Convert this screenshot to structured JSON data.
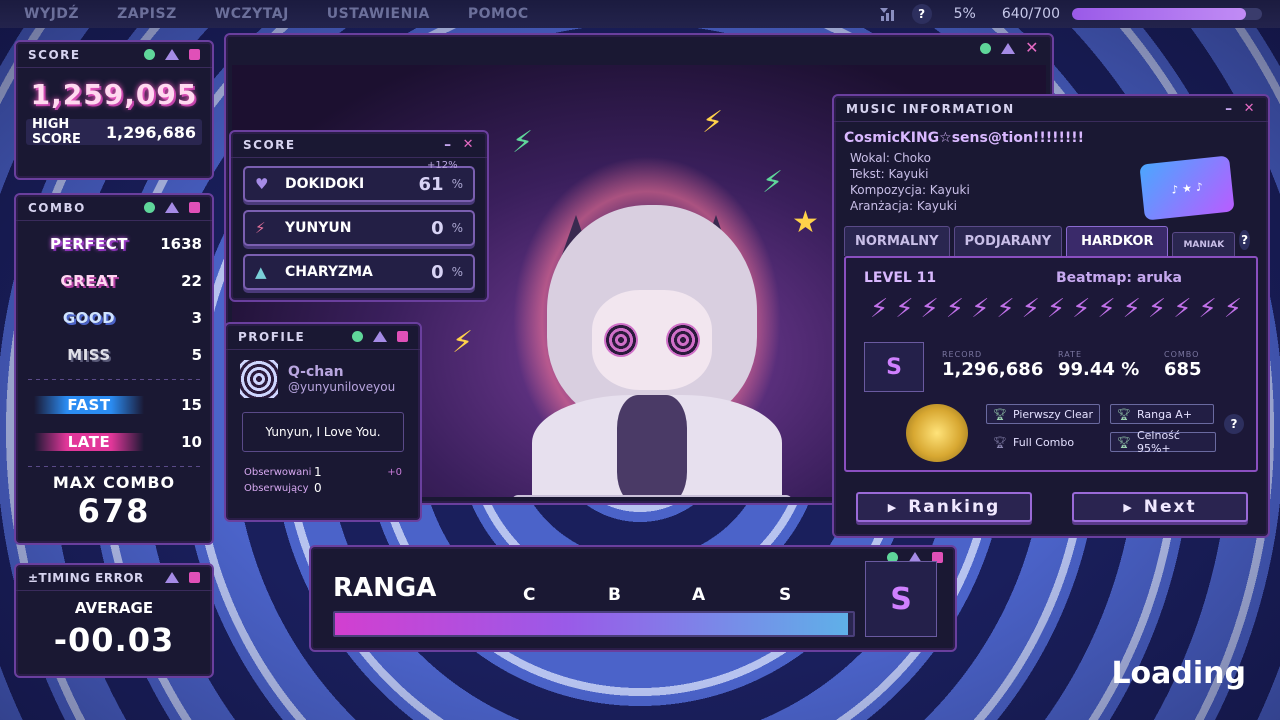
{
  "menu": [
    "WYJDŹ",
    "ZAPISZ",
    "WCZYTAJ",
    "USTAWIENIA",
    "POMOC"
  ],
  "topbar": {
    "help": "?",
    "percent": "5%",
    "progress_text": "640/700",
    "progress_fraction": 0.914
  },
  "score_panel": {
    "title": "SCORE",
    "score": "1,259,095",
    "high_score_label": "HIGH SCORE",
    "high_score": "1,296,686"
  },
  "combo_panel": {
    "title": "COMBO",
    "judgements": [
      {
        "label": "PERFECT",
        "value": "1638"
      },
      {
        "label": "GREAT",
        "value": "22"
      },
      {
        "label": "GOOD",
        "value": "3"
      },
      {
        "label": "MISS",
        "value": "5"
      }
    ],
    "fast": {
      "label": "FAST",
      "value": "15"
    },
    "late": {
      "label": "LATE",
      "value": "10"
    },
    "max_combo_label": "MAX COMBO",
    "max_combo": "678"
  },
  "timing_panel": {
    "title": "±TIMING ERROR",
    "average_label": "AVERAGE",
    "average": "-00.03"
  },
  "stats_panel": {
    "title": "SCORE",
    "bonus": "+12%",
    "rows": [
      {
        "label": "DOKIDOKI",
        "value": "61",
        "unit": "%",
        "icon": "heart-icon"
      },
      {
        "label": "YUNYUN",
        "value": "0",
        "unit": "%",
        "icon": "bolt-icon"
      },
      {
        "label": "CHARYZMA",
        "value": "0",
        "unit": "%",
        "icon": "eye-triangle-icon"
      }
    ]
  },
  "profile_panel": {
    "title": "PROFILE",
    "name": "Q-chan",
    "handle": "@yunyuniloveyou",
    "message": "Yunyun, I Love You.",
    "following_label": "Obserwowani",
    "following": "1",
    "following_delta": "+0",
    "followers_label": "Obserwujący",
    "followers": "0"
  },
  "music_panel": {
    "title": "MUSIC INFORMATION",
    "song": "CosmicKING☆sens@tion!!!!!!!!",
    "credits": [
      "Wokal: Choko",
      "Tekst: Kayuki",
      "Kompozycja: Kayuki",
      "Aranżacja: Kayuki"
    ],
    "tabs": [
      "NORMALNY",
      "PODJARANY",
      "HARDKOR",
      "MANIAK"
    ],
    "active_tab": "HARDKOR",
    "help": "?",
    "level": "LEVEL 11",
    "beatmap": "Beatmap: aruka",
    "difficulty_bolts": 15,
    "rank": "S",
    "record_label": "RECORD",
    "record": "1,296,686",
    "rate_label": "RATE",
    "rate": "99.44 %",
    "combo_label": "COMBO",
    "combo": "685",
    "achievements": [
      {
        "label": "Pierwszy Clear",
        "earned": true
      },
      {
        "label": "Ranga A+",
        "earned": true
      },
      {
        "label": "Full Combo",
        "earned": false
      },
      {
        "label": "Celność 95%+",
        "earned": true
      }
    ],
    "ranking_button": "Ranking",
    "next_button": "Next"
  },
  "rank_panel": {
    "title": "RANGA",
    "marks": [
      "C",
      "B",
      "A",
      "S"
    ],
    "fill_fraction": 0.99,
    "rank": "S"
  },
  "loading": "Loading",
  "colors": {
    "accent": "#c070e8",
    "panel_bg": "#1a1833",
    "panel_border": "#6a3f9e",
    "pink": "#e050b8",
    "green": "#5fd69a"
  }
}
